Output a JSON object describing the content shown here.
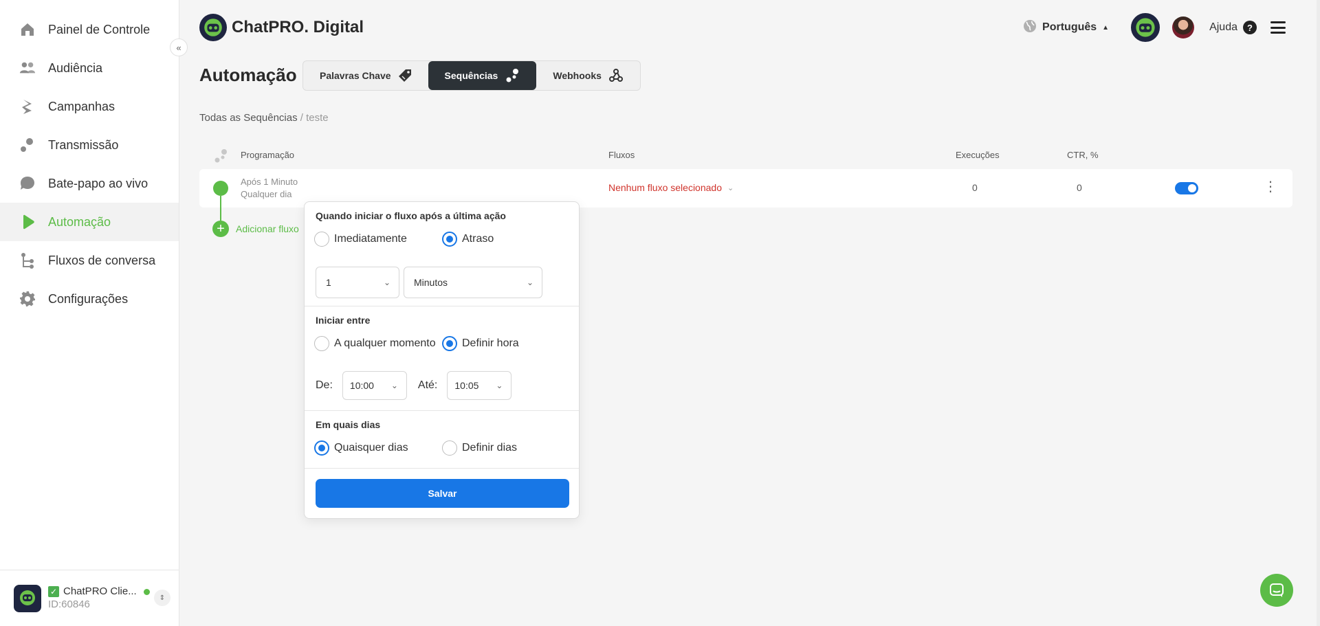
{
  "sidebar": {
    "items": [
      {
        "label": "Painel de Controle",
        "icon": "home-icon"
      },
      {
        "label": "Audiência",
        "icon": "users-icon"
      },
      {
        "label": "Campanhas",
        "icon": "campaign-icon"
      },
      {
        "label": "Transmissão",
        "icon": "broadcast-icon"
      },
      {
        "label": "Bate-papo ao vivo",
        "icon": "chat-icon"
      },
      {
        "label": "Automação",
        "icon": "play-icon",
        "active": true
      },
      {
        "label": "Fluxos de conversa",
        "icon": "flow-icon"
      },
      {
        "label": "Configurações",
        "icon": "gear-icon"
      }
    ],
    "collapse_glyph": "«",
    "account": {
      "name": "ChatPRO Clie...",
      "id": "ID:60846",
      "check_glyph": "✓",
      "switch_glyph": "⇕"
    }
  },
  "header": {
    "brand": "ChatPRO. Digital",
    "language": "Português",
    "language_caret": "▲",
    "help": "Ajuda",
    "help_glyph": "?"
  },
  "page": {
    "title": "Automação",
    "tabs": [
      {
        "label": "Palavras Chave",
        "icon": "tag-icon"
      },
      {
        "label": "Sequências",
        "icon": "sequence-icon",
        "active": true
      },
      {
        "label": "Webhooks",
        "icon": "webhook-icon"
      }
    ],
    "breadcrumb": {
      "root": "Todas as Sequências",
      "current": "/ teste"
    }
  },
  "table": {
    "headers": {
      "schedule": "Programação",
      "flows": "Fluxos",
      "executions": "Execuções",
      "ctr": "CTR, %"
    },
    "rows": [
      {
        "schedule_line1": "Após 1 Minuto",
        "schedule_line2": "Qualquer dia",
        "flow": "Nenhum fluxo selecionado",
        "flow_chevron": "⌄",
        "executions": "0",
        "ctr": "0",
        "enabled": true,
        "kebab_glyph": "⋮"
      }
    ],
    "add_glyph": "+",
    "add_flow_label": "Adicionar fluxo"
  },
  "popover": {
    "when": {
      "title": "Quando iniciar o fluxo após a última ação",
      "option_immediate": "Imediatamente",
      "option_delay": "Atraso",
      "selected": "delay",
      "amount": "1",
      "unit": "Minutos"
    },
    "between": {
      "title": "Iniciar entre",
      "option_any": "A qualquer momento",
      "option_set": "Definir hora",
      "selected": "set",
      "from_label": "De:",
      "from_value": "10:00",
      "to_label": "Até:",
      "to_value": "10:05"
    },
    "days": {
      "title": "Em quais dias",
      "option_any": "Quaisquer dias",
      "option_set": "Definir dias",
      "selected": "any"
    },
    "chevron_glyph": "⌄",
    "save_label": "Salvar"
  },
  "colors": {
    "accent_green": "#5cbc47",
    "primary_blue": "#1877e6",
    "error_red": "#d0342c",
    "dark_tab": "#2c3237"
  }
}
